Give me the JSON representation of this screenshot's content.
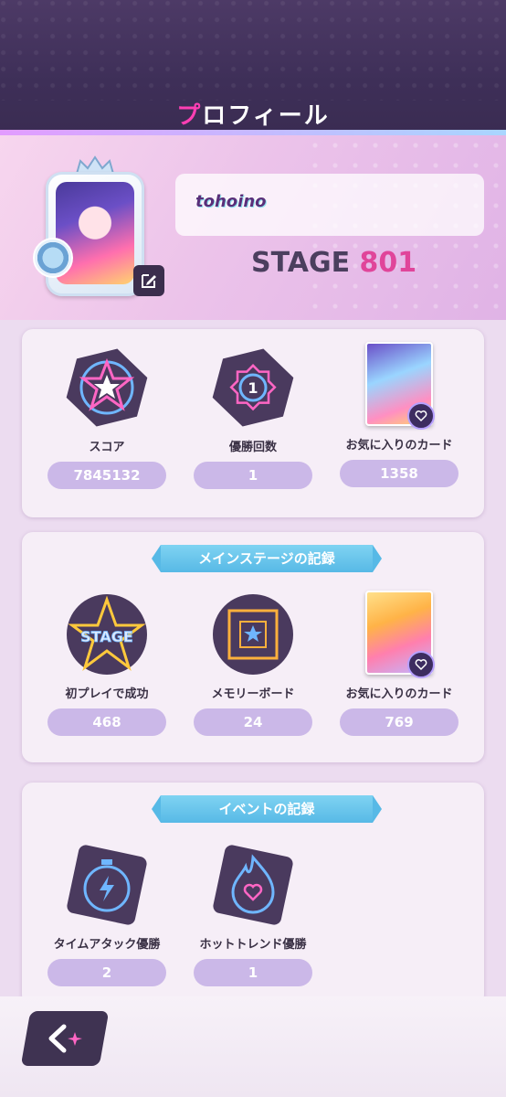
{
  "header": {
    "title_accent": "プ",
    "title_rest": "ロフィール"
  },
  "profile": {
    "username": "tohoino",
    "stage_label": "STAGE",
    "stage_number": "801"
  },
  "summary": {
    "stats": [
      {
        "label": "スコア",
        "value": "7845132",
        "icon": "star-hexagon-icon"
      },
      {
        "label": "優勝回数",
        "value": "1",
        "icon": "rank-one-icon"
      },
      {
        "label": "お気に入りのカード",
        "value": "1358",
        "icon": "favorite-card-thumbnail"
      }
    ]
  },
  "main_stage": {
    "title": "メインステージの記録",
    "stats": [
      {
        "label": "初プレイで成功",
        "value": "468",
        "icon": "stage-star-icon",
        "badge_text": "STAGE"
      },
      {
        "label": "メモリーボード",
        "value": "24",
        "icon": "memory-board-icon"
      },
      {
        "label": "お気に入りのカード",
        "value": "769",
        "icon": "favorite-card-thumbnail"
      }
    ]
  },
  "event": {
    "title": "イベントの記録",
    "stats": [
      {
        "label": "タイムアタック優勝",
        "value": "2",
        "icon": "stopwatch-icon"
      },
      {
        "label": "ホットトレンド優勝",
        "value": "1",
        "icon": "flame-heart-icon"
      }
    ]
  },
  "colors": {
    "accent_pink": "#ff3fb4",
    "stage_number": "#e0459a",
    "value_pill": "#cbb8e8",
    "ribbon": "#57b9e6",
    "dark_purple": "#3f3352"
  }
}
